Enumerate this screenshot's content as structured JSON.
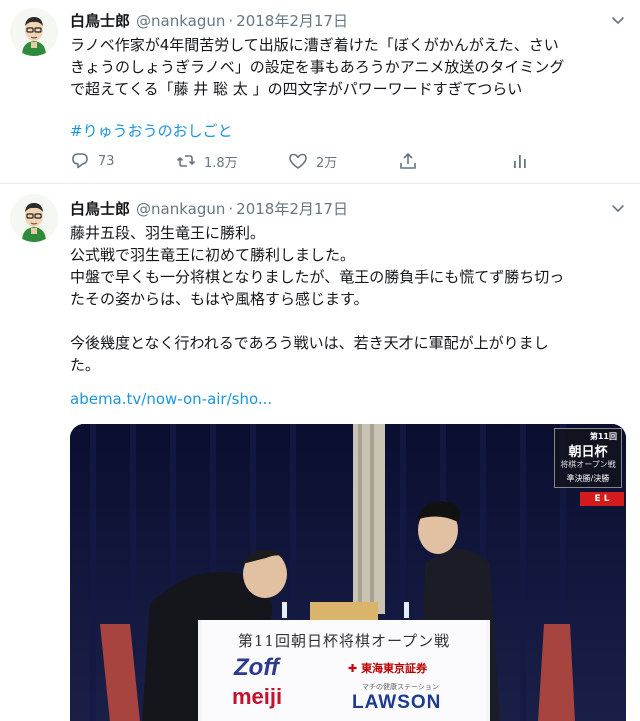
{
  "tweets": [
    {
      "name": "白鳥士郎",
      "handle": "@nankagun",
      "separator": "·",
      "date": "2018年2月17日",
      "lines": [
        "ラノベ作家が4年間苦労して出版に漕ぎ着けた「ぼくがかんがえた、さい",
        "きょうのしょうぎラノベ」の設定を事もあろうかアニメ放送のタイミング",
        "で超えてくる「藤 井 聡 太 」の四文字がパワーワードすぎてつらい"
      ],
      "hashtag": "#りゅうおうのおしごと",
      "actions": {
        "reply_icon": "reply-icon",
        "reply_count": "73",
        "retweet_icon": "retweet-icon",
        "retweet_count": "1.8万",
        "like_icon": "heart-icon",
        "like_count": "2万",
        "share_icon": "share-icon",
        "analytics_icon": "analytics-icon"
      }
    },
    {
      "name": "白鳥士郎",
      "handle": "@nankagun",
      "separator": "·",
      "date": "2018年2月17日",
      "lines": [
        "藤井五段、羽生竜王に勝利。",
        "公式戦で羽生竜王に初めて勝利しました。",
        "中盤で早くも一分将棋となりましたが、竜王の勝負手にも慌てず勝ち切っ",
        "たその姿からは、もはや風格すら感じます。",
        "",
        "今後幾度となく行われるであろう戦いは、若き天才に軍配が上がりまし",
        "た。"
      ],
      "link": "abema.tv/now-on-air/sho...",
      "media": {
        "banner_title": "第11回朝日杯将棋オープン戦",
        "sponsors": [
          "Zoff",
          "meiji",
          "東海東京証券",
          "LAWSON"
        ],
        "lawson_tagline": "マチの健康ステーション",
        "logo_number": "第11回",
        "logo_title": "朝日杯",
        "logo_subtitle": "将棋オープン戦",
        "logo_round": "準決勝/決勝",
        "live_badge": "E L"
      }
    }
  ],
  "colors": {
    "link": "#1b95e0",
    "secondary_text": "#657786",
    "primary_text": "#14171a",
    "divider": "#e6ecf0"
  }
}
